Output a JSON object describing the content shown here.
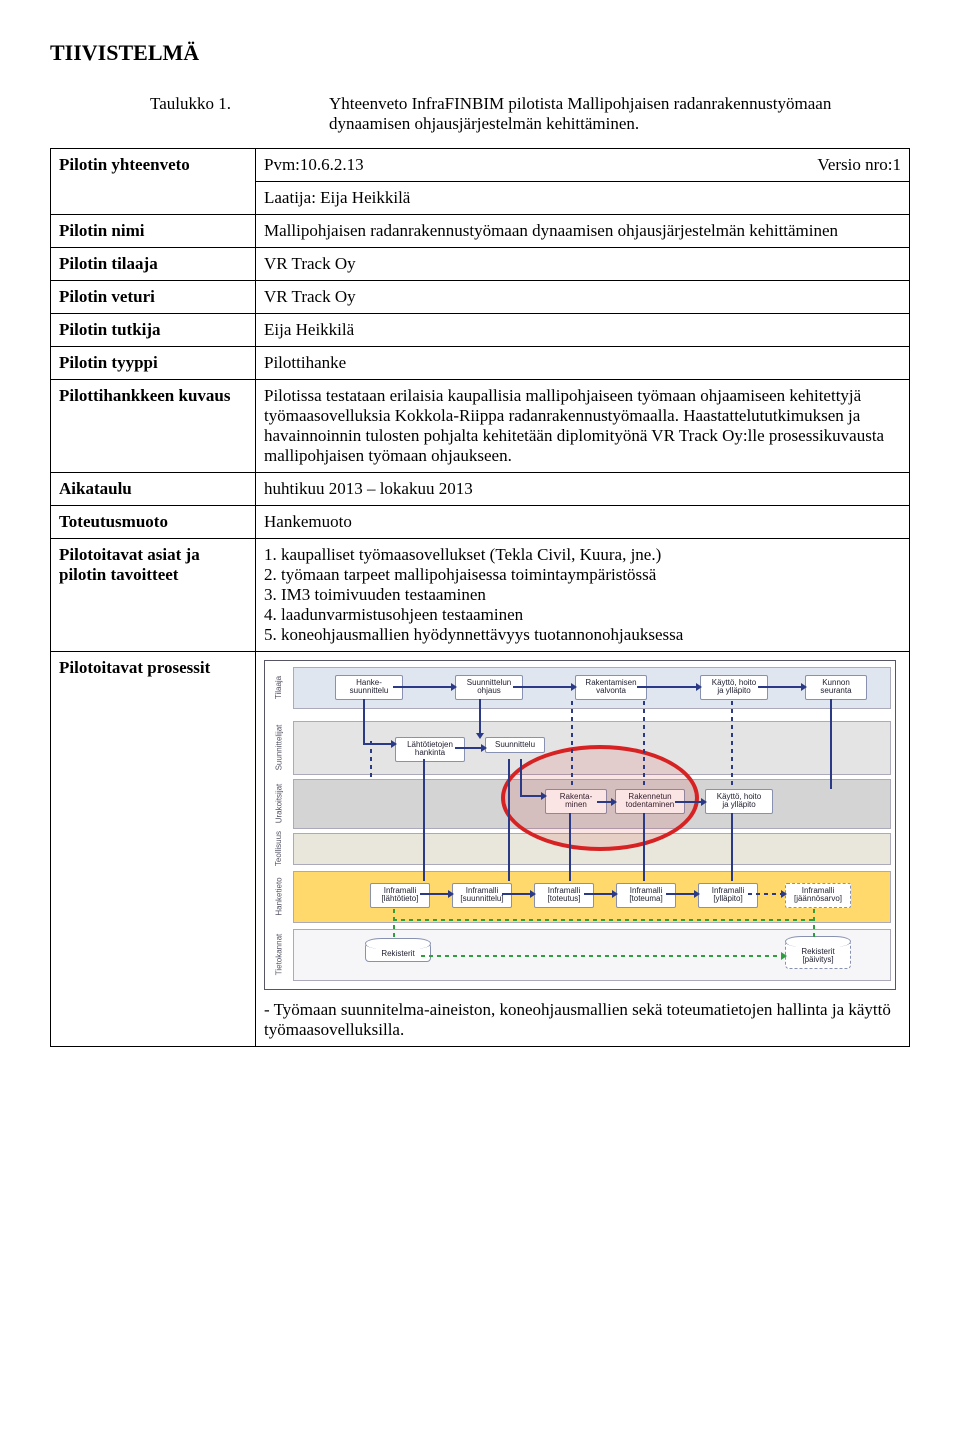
{
  "title": "TIIVISTELMÄ",
  "taulukko": {
    "label": "Taulukko 1.",
    "text": "Yhteenveto InfraFINBIM pilotista Mallipohjaisen radanrakennustyömaan dynaamisen ohjausjärjestelmän kehittäminen."
  },
  "rows": {
    "yhteenveto": {
      "label": "Pilotin yhteenveto",
      "pvm_label": "Pvm:",
      "pvm": "10.6.2.13",
      "versio_label": "Versio nro:",
      "versio": "1",
      "laatija_label": "Laatija:",
      "laatija": "Eija Heikkilä"
    },
    "nimi": {
      "label": "Pilotin nimi",
      "value": "Mallipohjaisen radanrakennustyömaan dynaamisen ohjausjärjestelmän kehittäminen"
    },
    "tilaaja": {
      "label": "Pilotin tilaaja",
      "value": "VR Track Oy"
    },
    "veturi": {
      "label": "Pilotin veturi",
      "value": "VR Track Oy"
    },
    "tutkija": {
      "label": "Pilotin tutkija",
      "value": "Eija Heikkilä"
    },
    "tyyppi": {
      "label": "Pilotin tyyppi",
      "value": "Pilottihanke"
    },
    "kuvaus": {
      "label": "Pilottihankkeen kuvaus",
      "value": "Pilotissa testataan erilaisia kaupallisia mallipohjaiseen työmaan ohjaamiseen kehitettyjä työmaasovelluksia Kokkola-Riippa radanrakennustyömaalla. Haastattelututkimuksen ja havainnoinnin tulosten pohjalta kehitetään diplomityönä VR Track Oy:lle prosessikuvausta mallipohjaisen työmaan ohjaukseen."
    },
    "aikataulu": {
      "label": "Aikataulu",
      "value": "huhtikuu 2013 – lokakuu 2013"
    },
    "toteutus": {
      "label": "Toteutusmuoto",
      "value": "Hankemuoto"
    },
    "tavoitteet": {
      "label": "Pilotoitavat asiat ja pilotin tavoitteet",
      "items": [
        "1. kaupalliset työmaasovellukset (Tekla Civil, Kuura, jne.)",
        "2. työmaan tarpeet mallipohjaisessa toimintaympäristössä",
        "3. IM3 toimivuuden testaaminen",
        "4. laadunvarmistusohjeen testaaminen",
        "5. koneohjausmallien hyödynnettävyys tuotannonohjauksessa"
      ]
    },
    "prosessit": {
      "label": "Pilotoitavat prosessit"
    }
  },
  "diagram": {
    "lanes": {
      "tilaaja": "Tilaaja",
      "suun": "Suunnittelijat",
      "urak": "Urakoitsijat",
      "teoll": "Teollisuus",
      "hanke": "Hanketieto",
      "tieto": "Tietokannat"
    },
    "boxes": {
      "hankesuun": "Hanke-\nsuunnittelu",
      "suunohj": "Suunnittelun\nohjaus",
      "rakvalv": "Rakentamisen\nvalvonta",
      "kaytto1": "Käyttö, hoito\nja ylläpito",
      "kunnon": "Kunnon\nseuranta",
      "lahto": "Lähtötietojen\nhankinta",
      "suunn": "Suunnittelu",
      "rakenta": "Rakenta-\nminen",
      "rakentod": "Rakennetun\ntodentaminen",
      "kaytto2": "Käyttö, hoito\nja ylläpito",
      "inflahto": "Inframalli\n[lähtötieto]",
      "infsuun": "Inframalli\n[suunnittelu]",
      "inftot": "Inframalli\n[toteutus]",
      "inftou": "Inframalli\n[toteuma]",
      "infyll": "Inframalli\n[ylläpito]",
      "infjaan": "Inframalli\n[jäännösarvo]",
      "rek1": "Rekisterit",
      "rek2": "Rekisterit\n[päivitys]"
    }
  },
  "bottom_note": "- Työmaan suunnitelma-aineiston, koneohjausmallien sekä toteumatietojen hallinta ja käyttö työmaasovelluksilla."
}
